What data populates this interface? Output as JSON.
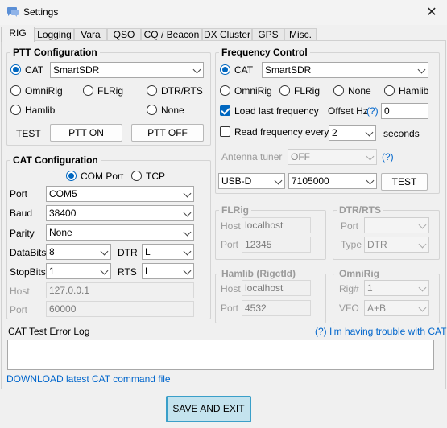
{
  "window": {
    "title": "Settings"
  },
  "tabs": [
    "RIG",
    "Logging",
    "Vara",
    "QSO",
    "CQ / Beacon",
    "DX Cluster",
    "GPS",
    "Misc."
  ],
  "ptt": {
    "title": "PTT Configuration",
    "cat_label": "CAT",
    "cat_value": "SmartSDR",
    "omnirig": "OmniRig",
    "flrig": "FLRig",
    "dtr_rts": "DTR/RTS",
    "hamlib": "Hamlib",
    "none": "None",
    "test_label": "TEST",
    "ptt_on": "PTT ON",
    "ptt_off": "PTT OFF"
  },
  "cat": {
    "title": "CAT Configuration",
    "com_port": "COM Port",
    "tcp": "TCP",
    "port_label": "Port",
    "port_value": "COM5",
    "baud_label": "Baud",
    "baud_value": "38400",
    "parity_label": "Parity",
    "parity_value": "None",
    "databits_label": "DataBits",
    "databits_value": "8",
    "dtr_label": "DTR",
    "dtr_value": "L",
    "stopbits_label": "StopBits",
    "stopbits_value": "1",
    "rts_label": "RTS",
    "rts_value": "L",
    "host_label": "Host",
    "host_value": "127.0.0.1",
    "port2_label": "Port",
    "port2_value": "60000"
  },
  "freq": {
    "title": "Frequency Control",
    "cat_label": "CAT",
    "cat_value": "SmartSDR",
    "omnirig": "OmniRig",
    "flrig": "FLRig",
    "none": "None",
    "hamlib": "Hamlib",
    "load_last": "Load last frequency",
    "offset_label": "Offset Hz",
    "help": "(?)",
    "offset_value": "0",
    "read_every": "Read frequency every",
    "read_value": "2",
    "seconds": "seconds",
    "antenna_label": "Antenna tuner",
    "antenna_value": "OFF",
    "mode_value": "USB-D",
    "freq_value": "7105000",
    "test": "TEST"
  },
  "flrig": {
    "title": "FLRig",
    "host_label": "Host",
    "host_value": "localhost",
    "port_label": "Port",
    "port_value": "12345"
  },
  "dtrrts": {
    "title": "DTR/RTS",
    "port_label": "Port",
    "port_value": "",
    "type_label": "Type",
    "type_value": "DTR"
  },
  "hamlib": {
    "title": "Hamlib (RigctId)",
    "host_label": "Host",
    "host_value": "localhost",
    "port_label": "Port",
    "port_value": "4532"
  },
  "omnirig": {
    "title": "OmniRig",
    "rig_label": "Rig#",
    "rig_value": "1",
    "vfo_label": "VFO",
    "vfo_value": "A+B"
  },
  "log": {
    "label": "CAT Test Error Log",
    "help_link": "(?) I'm having trouble with CAT",
    "download_link": "DOWNLOAD latest CAT command file"
  },
  "footer": {
    "save": "SAVE AND EXIT"
  }
}
